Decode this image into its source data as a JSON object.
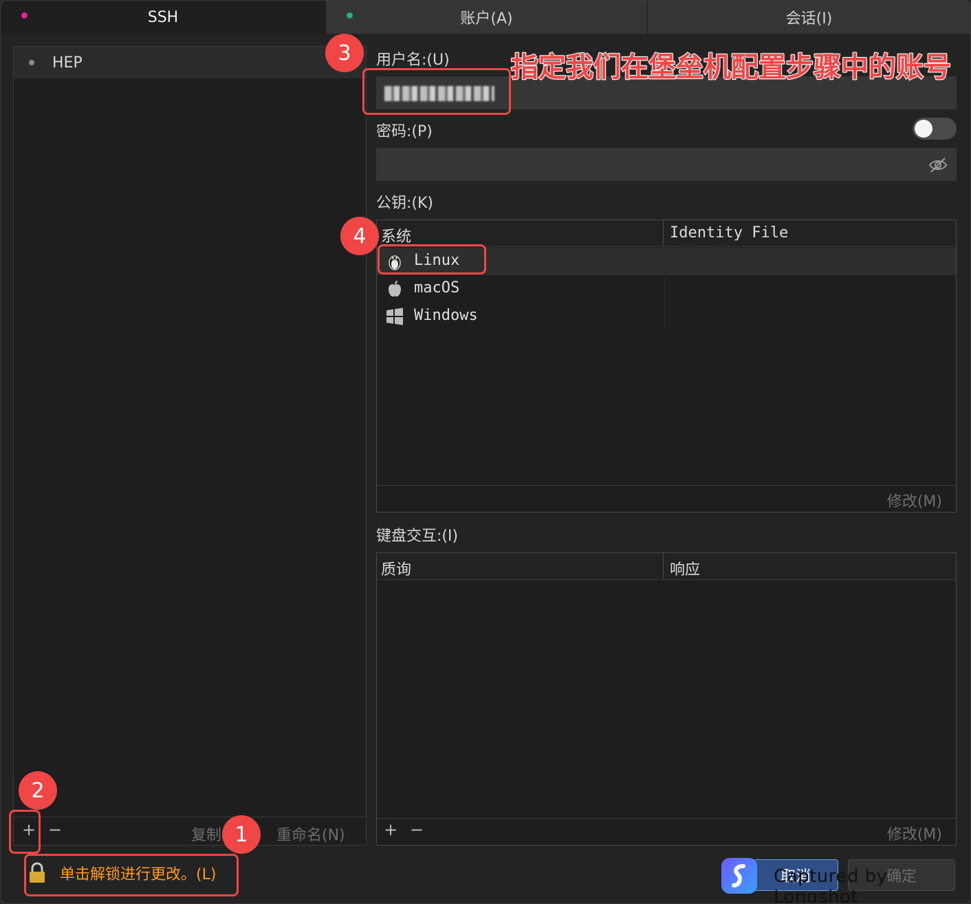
{
  "tabs": [
    {
      "label": "SSH"
    },
    {
      "label": "账户(A)"
    },
    {
      "label": "会话(I)"
    }
  ],
  "hosts": [
    {
      "name": "HEP"
    }
  ],
  "left_footer": {
    "add": "+",
    "remove": "−",
    "copy": "复制",
    "rename": "重命名(N)"
  },
  "lock": {
    "text": "单击解锁进行更改。(L)"
  },
  "username": {
    "label": "用户名:(U)",
    "value": ""
  },
  "password": {
    "label": "密码:(P)"
  },
  "pubkey": {
    "label": "公钥:(K)",
    "columns": [
      "系统",
      "Identity File"
    ],
    "rows": [
      {
        "system": "Linux",
        "icon": "linux-tux-icon",
        "file": ""
      },
      {
        "system": "macOS",
        "icon": "apple-icon",
        "file": ""
      },
      {
        "system": "Windows",
        "icon": "windows-icon",
        "file": ""
      }
    ],
    "modify": "修改(M)"
  },
  "keyboard_interactive": {
    "label": "键盘交互:(I)",
    "columns": [
      "质询",
      "响应"
    ],
    "add": "+",
    "remove": "−",
    "modify": "修改(M)"
  },
  "buttons": {
    "cancel": "取消",
    "ok": "确定"
  },
  "annotations": {
    "b1": "1",
    "b2": "2",
    "b3": "3",
    "b4": "4",
    "note": "指定我们在堡垒机配置步骤中的账号"
  },
  "watermark": "Captured by Longshot",
  "colors": {
    "accent_warning": "#ff9a1f",
    "annotation_red": "#f04646",
    "tab_dot_ssh": "#e8209c",
    "tab_dot_account": "#21b36b"
  }
}
